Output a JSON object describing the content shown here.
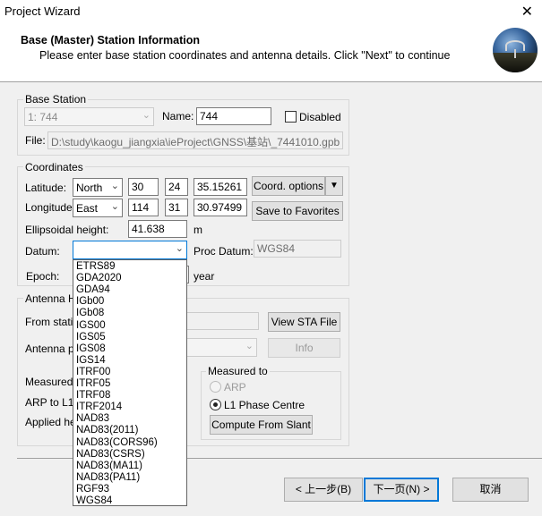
{
  "window": {
    "title": "Project Wizard",
    "close_glyph": "✕"
  },
  "header": {
    "title": "Base (Master) Station Information",
    "subtitle": "Please enter base station coordinates and antenna details. Click \"Next\" to continue"
  },
  "base_station": {
    "group_label": "Base Station",
    "station_select": "1: 744",
    "name_label": "Name:",
    "name_value": "744",
    "disabled_label": "Disabled",
    "disabled_checked": false,
    "file_label": "File:",
    "file_value": "D:\\study\\kaogu_jiangxia\\ieProject\\GNSS\\基站\\_7441010.gpb"
  },
  "coordinates": {
    "group_label": "Coordinates",
    "latitude_label": "Latitude:",
    "lat_hemisphere": "North",
    "lat_deg": "30",
    "lat_min": "24",
    "lat_sec": "35.15261",
    "longitude_label": "Longitude:",
    "lon_hemisphere": "East",
    "lon_deg": "114",
    "lon_min": "31",
    "lon_sec": "30.97499",
    "coord_options_label": "Coord. options",
    "save_favorites_label": "Save to Favorites",
    "ellipsoidal_label": "Ellipsoidal height:",
    "ellipsoidal_value": "41.638",
    "ellipsoidal_unit": "m",
    "datum_label": "Datum:",
    "datum_value": "",
    "proc_datum_label": "Proc Datum:",
    "proc_datum_value": "WGS84",
    "epoch_label": "Epoch:",
    "epoch_unit": "year"
  },
  "antenna": {
    "group_label": "Antenna He",
    "from_station_label": "From station",
    "view_sta_label": "View STA File",
    "antenna_profile_label": "Antenna pr",
    "info_label": "Info",
    "measured_label": "Measured h",
    "arp_l1_label": "ARP to L1 c",
    "applied_label": "Applied hei",
    "measured_to_label": "Measured to",
    "radio_arp": "ARP",
    "radio_l1": "L1 Phase Centre",
    "selected_radio": "L1 Phase Centre",
    "compute_slant_label": "Compute From Slant"
  },
  "datum_dropdown": {
    "options": [
      "ETRS89",
      "GDA2020",
      "GDA94",
      "IGb00",
      "IGb08",
      "IGS00",
      "IGS05",
      "IGS08",
      "IGS14",
      "ITRF00",
      "ITRF05",
      "ITRF08",
      "ITRF2014",
      "NAD83",
      "NAD83(2011)",
      "NAD83(CORS96)",
      "NAD83(CSRS)",
      "NAD83(MA11)",
      "NAD83(PA11)",
      "RGF93",
      "WGS84"
    ],
    "highlighted": "WGS84"
  },
  "footer": {
    "back_label": "< 上一步(B)",
    "next_label": "下一页(N) >",
    "cancel_label": "取消"
  },
  "colors": {
    "accent": "#0078d7",
    "highlight_box": "#e0222b"
  }
}
